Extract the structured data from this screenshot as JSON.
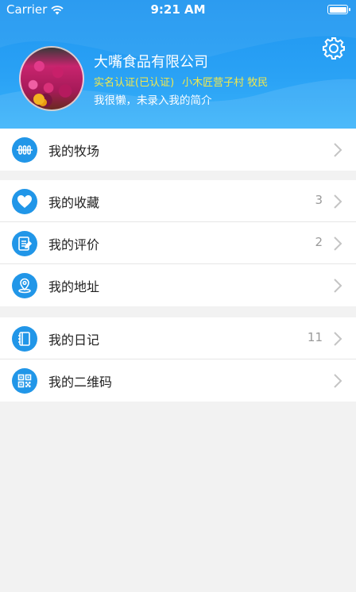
{
  "status_bar": {
    "carrier": "Carrier",
    "time": "9:21 AM"
  },
  "profile": {
    "company": "大嘴食品有限公司",
    "verification": "实名认证(已认证)",
    "location": "小木匠营子村 牧民",
    "bio": "我很懒，未录入我的简介"
  },
  "menu": {
    "ranch": {
      "label": "我的牧场"
    },
    "favorites": {
      "label": "我的收藏",
      "count": "3"
    },
    "reviews": {
      "label": "我的评价",
      "count": "2"
    },
    "address": {
      "label": "我的地址"
    },
    "diary": {
      "label": "我的日记",
      "count": "11"
    },
    "qrcode": {
      "label": "我的二维码"
    }
  },
  "colors": {
    "header": "#2aa2f5",
    "accent": "#2196e8",
    "verify_text": "#f2e84b"
  },
  "icons": [
    "wifi-icon",
    "battery-icon",
    "settings-gear-icon",
    "ranch-icon",
    "heart-icon",
    "review-icon",
    "location-pin-icon",
    "notebook-icon",
    "qr-code-icon",
    "chevron-right-icon"
  ]
}
